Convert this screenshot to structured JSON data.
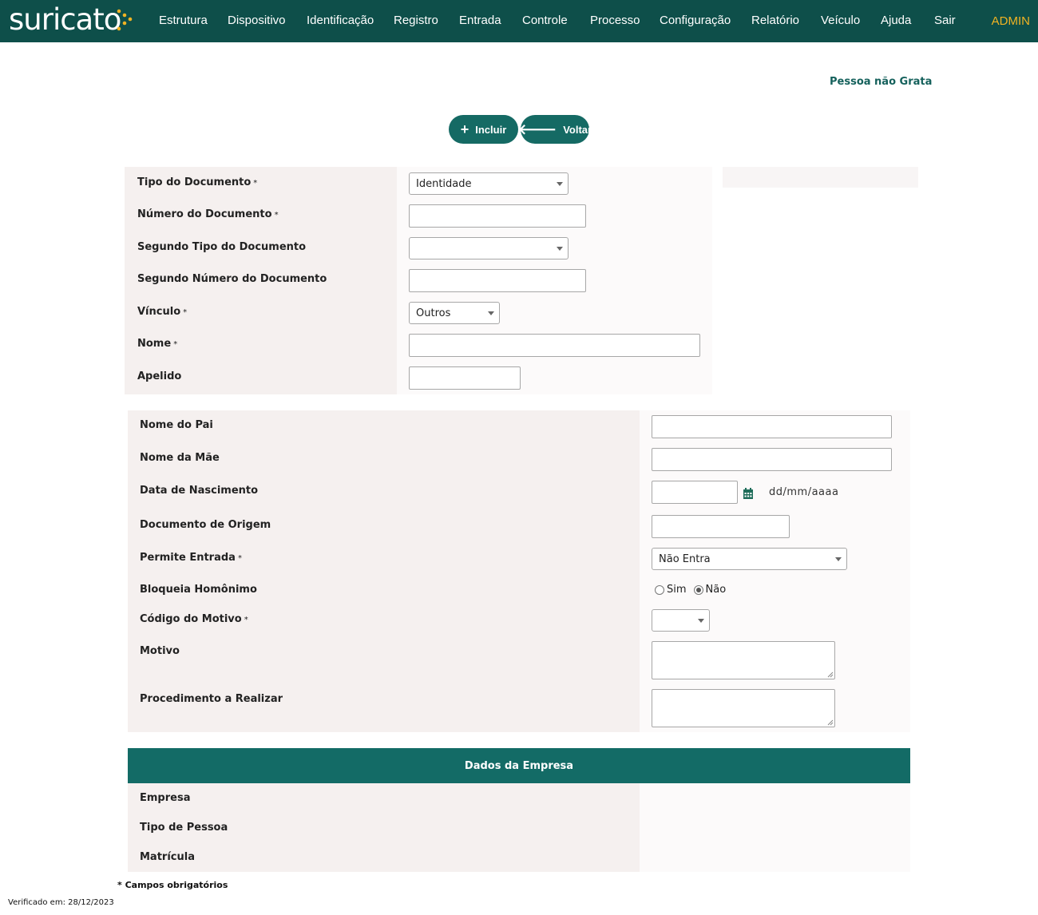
{
  "app": {
    "logo_text": "suricato",
    "nav": [
      "Estrutura",
      "Dispositivo",
      "Identificação",
      "Registro",
      "Entrada",
      "Controle",
      "Processo",
      "Configuração",
      "Relatório",
      "Veículo",
      "Ajuda",
      "Sair"
    ],
    "user": "ADMIN",
    "colors": {
      "nav_bg": "#0e4f4a",
      "accent": "#156a64",
      "user": "#f0b323",
      "logo_dots": "#f0b323"
    }
  },
  "page": {
    "title": "Pessoa não Grata",
    "buttons": {
      "include": {
        "label": "Incluir",
        "icon": "plus-icon"
      },
      "back": {
        "label": "Voltar",
        "icon": "arrow-left-icon"
      }
    }
  },
  "form1": {
    "tipo_documento": {
      "label": "Tipo do Documento",
      "required": "*",
      "value": "Identidade"
    },
    "numero_documento": {
      "label": "Número do Documento",
      "required": "*",
      "value": ""
    },
    "segundo_tipo": {
      "label": "Segundo Tipo do Documento",
      "value": ""
    },
    "segundo_numero": {
      "label": "Segundo Número do Documento",
      "value": ""
    },
    "vinculo": {
      "label": "Vínculo",
      "required": "*",
      "value": "Outros"
    },
    "nome": {
      "label": "Nome",
      "required": "*",
      "value": ""
    },
    "apelido": {
      "label": "Apelido",
      "value": ""
    }
  },
  "form2": {
    "nome_pai": {
      "label": "Nome do Pai",
      "value": ""
    },
    "nome_mae": {
      "label": "Nome da Mãe",
      "value": ""
    },
    "data_nascimento": {
      "label": "Data de Nascimento",
      "value": "",
      "hint": "dd/mm/aaaa",
      "icon": "calendar-icon"
    },
    "documento_origem": {
      "label": "Documento de Origem",
      "value": ""
    },
    "permite_entrada": {
      "label": "Permite Entrada",
      "required": "*",
      "value": "Não Entra"
    },
    "bloqueia_homonimo": {
      "label": "Bloqueia Homônimo",
      "options": [
        "Sim",
        "Não"
      ],
      "selected": "Não"
    },
    "codigo_motivo": {
      "label": "Código do Motivo",
      "required": "*",
      "value": ""
    },
    "motivo": {
      "label": "Motivo",
      "value": ""
    },
    "procedimento": {
      "label": "Procedimento a Realizar",
      "value": ""
    }
  },
  "empresa": {
    "header": "Dados da Empresa",
    "labels": [
      "Empresa",
      "Tipo de Pessoa",
      "Matrícula"
    ]
  },
  "footer": {
    "required_note": "* Campos obrigatórios",
    "verified": "Verificado em: 28/12/2023"
  }
}
